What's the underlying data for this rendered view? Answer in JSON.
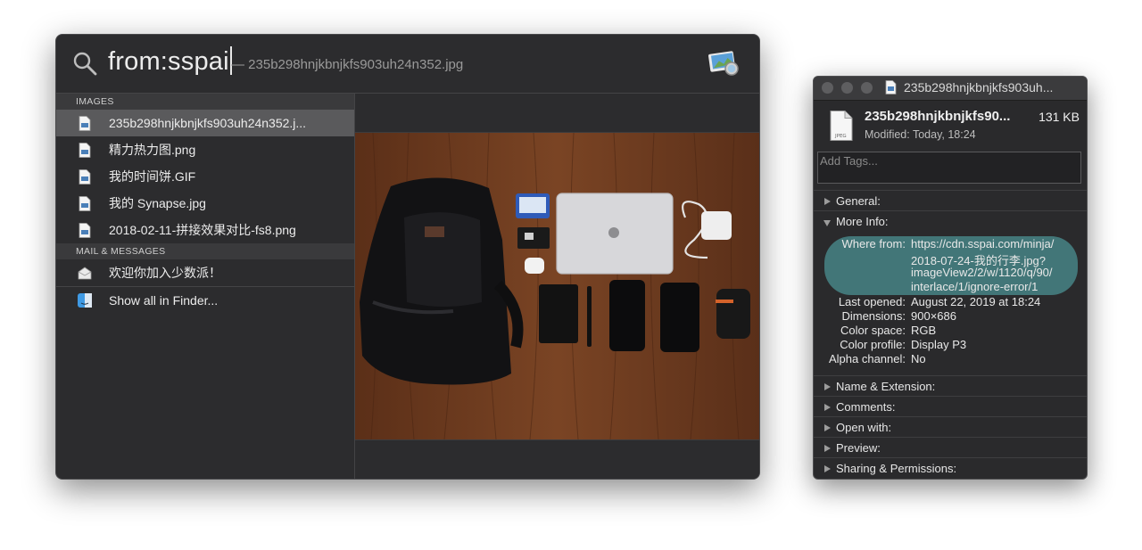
{
  "spotlight": {
    "query": "from:sspai",
    "selected_hint": "— 235b298hnjkbnjkfs903uh24n352.jpg",
    "sections": [
      {
        "header": "IMAGES",
        "items": [
          {
            "label": "235b298hnjkbnjkfs903uh24n352.j...",
            "selected": true
          },
          {
            "label": "精力热力图.png"
          },
          {
            "label": "我的时间饼.GIF"
          },
          {
            "label": "我的 Synapse.jpg"
          },
          {
            "label": "2018-02-11-拼接效果对比-fs8.png"
          }
        ]
      },
      {
        "header": "MAIL & MESSAGES",
        "items": [
          {
            "label": "欢迎你加入少数派！"
          }
        ]
      }
    ],
    "show_all": "Show all in Finder..."
  },
  "info_window": {
    "title": "235b298hnjkbnjkfs903uh...",
    "file_name": "235b298hnjkbnjkfs90...",
    "file_size": "131 KB",
    "modified": "Modified: Today, 18:24",
    "tags_placeholder": "Add Tags...",
    "general": "General:",
    "more_info": "More Info:",
    "where_from_label": "Where from:",
    "where_from": [
      "https://cdn.sspai.com/minja/",
      "2018-07-24-我的行李.jpg?",
      "imageView2/2/w/1120/q/90/",
      "interlace/1/ignore-error/1"
    ],
    "details": [
      {
        "label": "Last opened:",
        "value": "August 22, 2019 at 18:24"
      },
      {
        "label": "Dimensions:",
        "value": "900×686"
      },
      {
        "label": "Color space:",
        "value": "RGB"
      },
      {
        "label": "Color profile:",
        "value": "Display P3"
      },
      {
        "label": "Alpha channel:",
        "value": "No"
      }
    ],
    "sections": [
      "Name & Extension:",
      "Comments:",
      "Open with:",
      "Preview:",
      "Sharing & Permissions:"
    ]
  },
  "colors": {
    "window_bg": "#2c2c2e",
    "selection": "#5a5a5c",
    "where_from_highlight": "#427678",
    "wood": "#6b3a20"
  }
}
